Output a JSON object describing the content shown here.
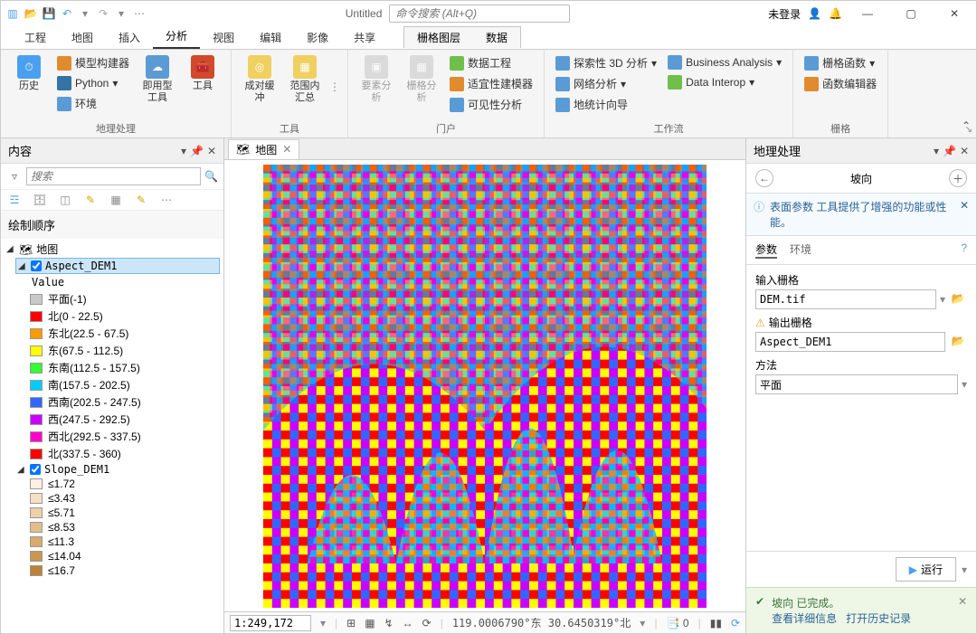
{
  "titlebar": {
    "doc_title": "Untitled",
    "search_placeholder": "命令搜索 (Alt+Q)",
    "login_status": "未登录"
  },
  "main_tabs": [
    "工程",
    "地图",
    "插入",
    "分析",
    "视图",
    "编辑",
    "影像",
    "共享"
  ],
  "active_tab_index": 3,
  "ctx_tabs": [
    "栅格图层",
    "数据"
  ],
  "ribbon": {
    "groups": [
      {
        "label": "地理处理",
        "big": [
          {
            "cap": "历史"
          }
        ],
        "small": [
          "模型构建器",
          "Python",
          "环境"
        ],
        "big2": [
          {
            "cap": "即用型工具"
          },
          {
            "cap": "工具"
          }
        ]
      },
      {
        "label": "工具",
        "big": [
          {
            "cap": "成对缓冲"
          },
          {
            "cap": "范围内汇总"
          }
        ]
      },
      {
        "label": "门户",
        "big_disabled": [
          {
            "cap": "要素分析"
          },
          {
            "cap": "栅格分析"
          }
        ],
        "small": [
          "数据工程",
          "适宜性建模器",
          "可见性分析"
        ]
      },
      {
        "label": "工作流",
        "small": [
          "探索性 3D 分析",
          "网络分析",
          "地统计向导",
          "Business Analysis",
          "Data Interop"
        ]
      },
      {
        "label": "栅格",
        "small": [
          "栅格函数",
          "函数编辑器"
        ]
      }
    ]
  },
  "contents": {
    "title": "内容",
    "search_placeholder": "搜索",
    "order_label": "绘制顺序",
    "map_label": "地图",
    "layers": [
      {
        "name": "Aspect_DEM1",
        "checked": true,
        "selected": true,
        "value_header": "Value",
        "legend": [
          {
            "c": "#c9c9c9",
            "t": "平面(-1)"
          },
          {
            "c": "#ff0000",
            "t": "北(0 - 22.5)"
          },
          {
            "c": "#ff9900",
            "t": "东北(22.5 - 67.5)"
          },
          {
            "c": "#ffff00",
            "t": "东(67.5 - 112.5)"
          },
          {
            "c": "#33ff33",
            "t": "东南(112.5 - 157.5)"
          },
          {
            "c": "#00ccff",
            "t": "南(157.5 - 202.5)"
          },
          {
            "c": "#3366ff",
            "t": "西南(202.5 - 247.5)"
          },
          {
            "c": "#cc00ff",
            "t": "西(247.5 - 292.5)"
          },
          {
            "c": "#ff00cc",
            "t": "西北(292.5 - 337.5)"
          },
          {
            "c": "#ff0000",
            "t": "北(337.5 - 360)"
          }
        ]
      },
      {
        "name": "Slope_DEM1",
        "checked": true,
        "legend": [
          {
            "c": "#fdf0e2",
            "t": "≤1.72"
          },
          {
            "c": "#f5e0c6",
            "t": "≤3.43"
          },
          {
            "c": "#edcfa8",
            "t": "≤5.71"
          },
          {
            "c": "#e3bd8a",
            "t": "≤8.53"
          },
          {
            "c": "#d8aa6c",
            "t": "≤11.3"
          },
          {
            "c": "#cb9650",
            "t": "≤14.04"
          },
          {
            "c": "#bd8236",
            "t": "≤16.7"
          }
        ]
      }
    ]
  },
  "map_view": {
    "tab_label": "地图",
    "scale": "1:249,172",
    "coords": "119.0006790°东 30.6450319°北",
    "selcount": "0"
  },
  "gp": {
    "title": "地理处理",
    "tool_name": "坡向",
    "info": "表面参数 工具提供了增强的功能或性能。",
    "subtabs": [
      "参数",
      "环境"
    ],
    "params": {
      "input_label": "输入栅格",
      "input_value": "DEM.tif",
      "output_label": "输出栅格",
      "output_value": "Aspect_DEM1",
      "method_label": "方法",
      "method_value": "平面"
    },
    "run_label": "运行",
    "msg_title": "坡向 已完成。",
    "link1": "查看详细信息",
    "link2": "打开历史记录"
  }
}
